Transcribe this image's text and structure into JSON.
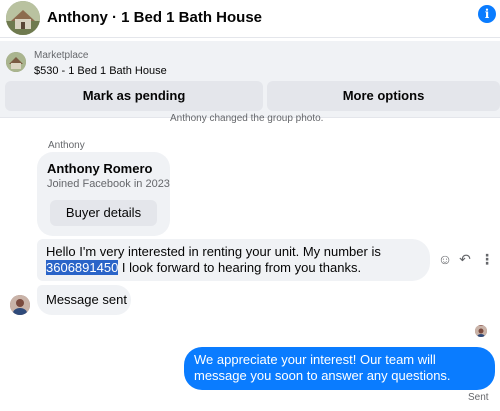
{
  "header": {
    "title": "Anthony · 1 Bed 1 Bath House",
    "info_icon": "info-icon",
    "info_glyph": "i"
  },
  "marketplace": {
    "source": "Marketplace",
    "listing": "$530 - 1 Bed 1 Bath House",
    "pending_label": "Mark as pending",
    "more_label": "More options"
  },
  "system_note": "Anthony changed the group photo.",
  "conversation": {
    "sender_name": "Anthony",
    "profile_card": {
      "name": "Anthony Romero",
      "joined": "Joined Facebook in 2023",
      "button_label": "Buyer details"
    },
    "incoming": [
      {
        "text_before": "Hello I'm very interested in renting your unit. My number is ",
        "highlight": "3606891450",
        "text_after": " I look forward to hearing from you thanks."
      },
      {
        "text": "Message sent"
      }
    ],
    "actions": {
      "emoji_glyph": "☺",
      "reply_glyph": "↶",
      "more_glyph": "⋮"
    },
    "outgoing": {
      "text": "We appreciate your interest! Our team will message you soon to answer any questions.",
      "status": "Sent"
    }
  },
  "colors": {
    "accent": "#0a7cff",
    "bubble_in": "#f0f2f5",
    "selection": "#2a64c8",
    "muted_text": "#65676b"
  }
}
